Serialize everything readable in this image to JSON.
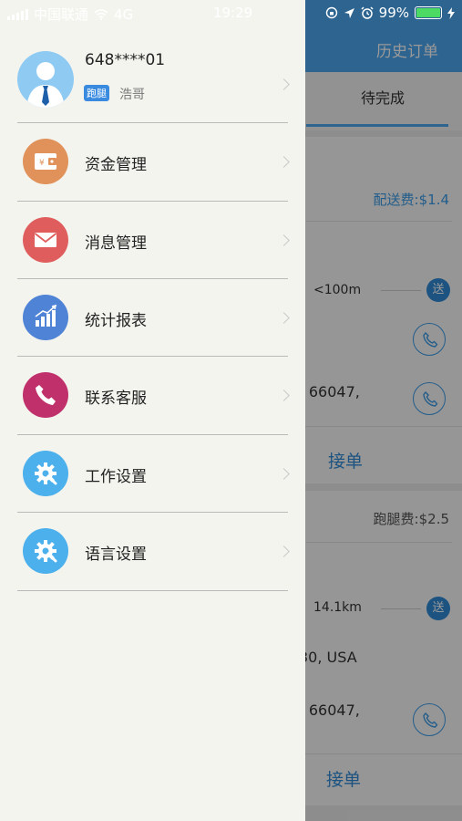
{
  "status_bar": {
    "carrier": "中国联通",
    "network": "4G",
    "time": "19:29",
    "battery": "99%",
    "battery_level": 0.99
  },
  "background_app": {
    "history_orders": "历史订单",
    "tab_pending": "待完成",
    "orders": [
      {
        "fee": "配送费:$1.4",
        "distance": "<100m",
        "send_badge": "送",
        "address": "- 66047,",
        "accept": "接单"
      },
      {
        "fee": "跑腿费:$2.5",
        "distance": "14.1km",
        "send_badge": "送",
        "address_1": "30, USA",
        "address_2": "- 66047,",
        "accept": "接单"
      }
    ]
  },
  "drawer": {
    "profile": {
      "phone": "648****01",
      "role_badge": "跑腿",
      "nickname": "浩哥"
    },
    "menu": [
      {
        "label": "资金管理",
        "icon": "wallet-icon",
        "color": "#e0925a"
      },
      {
        "label": "消息管理",
        "icon": "envelope-icon",
        "color": "#e05d5d"
      },
      {
        "label": "统计报表",
        "icon": "bar-chart-icon",
        "color": "#4f83d6"
      },
      {
        "label": "联系客服",
        "icon": "phone-icon",
        "color": "#c0306b"
      },
      {
        "label": "工作设置",
        "icon": "gear-icon",
        "color": "#4bb0ec"
      },
      {
        "label": "语言设置",
        "icon": "gear-icon",
        "color": "#4bb0ec"
      }
    ]
  }
}
